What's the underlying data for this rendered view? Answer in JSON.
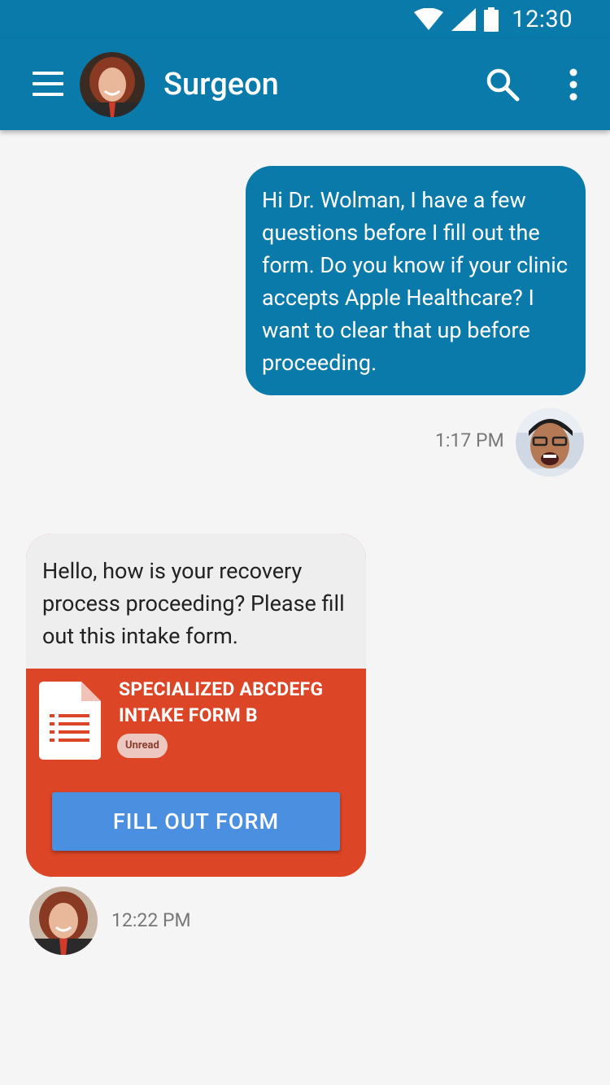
{
  "status": {
    "time": "12:30"
  },
  "header": {
    "title": "Surgeon"
  },
  "messages": {
    "outgoing": {
      "text": "Hi Dr. Wolman, I have a few questions before I fill out the form. Do you know if your clinic accepts Apple Healthcare? I want to clear that up before proceeding.",
      "time": "1:17 PM"
    },
    "incoming": {
      "text": "Hello, how is your recovery process proceeding? Please fill out this intake form.",
      "form_title": "SPECIALIZED ABCDEFG INTAKE FORM B",
      "badge": "Unread",
      "button": "FILL OUT FORM",
      "time": "12:22 PM"
    }
  },
  "colors": {
    "primary": "#0a7aab",
    "form_card": "#dc4526",
    "button": "#4a8fe0",
    "background": "#f5f5f5"
  },
  "icons": [
    "menu-icon",
    "search-icon",
    "more-vert-icon",
    "wifi-icon",
    "signal-icon",
    "battery-icon",
    "document-icon"
  ]
}
